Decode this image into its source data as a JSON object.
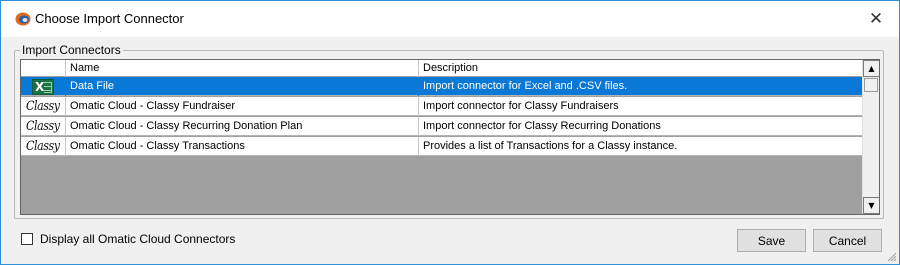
{
  "window": {
    "title": "Choose Import Connector",
    "close_glyph": "✕",
    "border_color": "#2e8fd6"
  },
  "groupbox": {
    "legend": "Import Connectors"
  },
  "table": {
    "columns": [
      "",
      "Name",
      "Description"
    ],
    "rows": [
      {
        "icon": "excel-icon",
        "name": "Data File",
        "description": "Import connector for Excel and .CSV files.",
        "selected": true
      },
      {
        "icon": "classy-logo",
        "logo_text": "Classy",
        "name": "Omatic Cloud - Classy Fundraiser",
        "description": "Import connector for Classy Fundraisers",
        "selected": false
      },
      {
        "icon": "classy-logo",
        "logo_text": "Classy",
        "name": "Omatic Cloud - Classy Recurring Donation Plan",
        "description": "Import connector for Classy Recurring Donations",
        "selected": false
      },
      {
        "icon": "classy-logo",
        "logo_text": "Classy",
        "name": "Omatic Cloud - Classy Transactions",
        "description": "Provides a list of Transactions for a Classy instance.",
        "selected": false
      }
    ],
    "selection_color": "#0a78d7",
    "empty_area_color": "#a0a0a0"
  },
  "scrollbar": {
    "up_glyph": "▲",
    "down_glyph": "▼"
  },
  "options": {
    "display_all_label": "Display all Omatic Cloud Connectors",
    "display_all_checked": false
  },
  "buttons": {
    "save_label": "Save",
    "cancel_label": "Cancel"
  }
}
